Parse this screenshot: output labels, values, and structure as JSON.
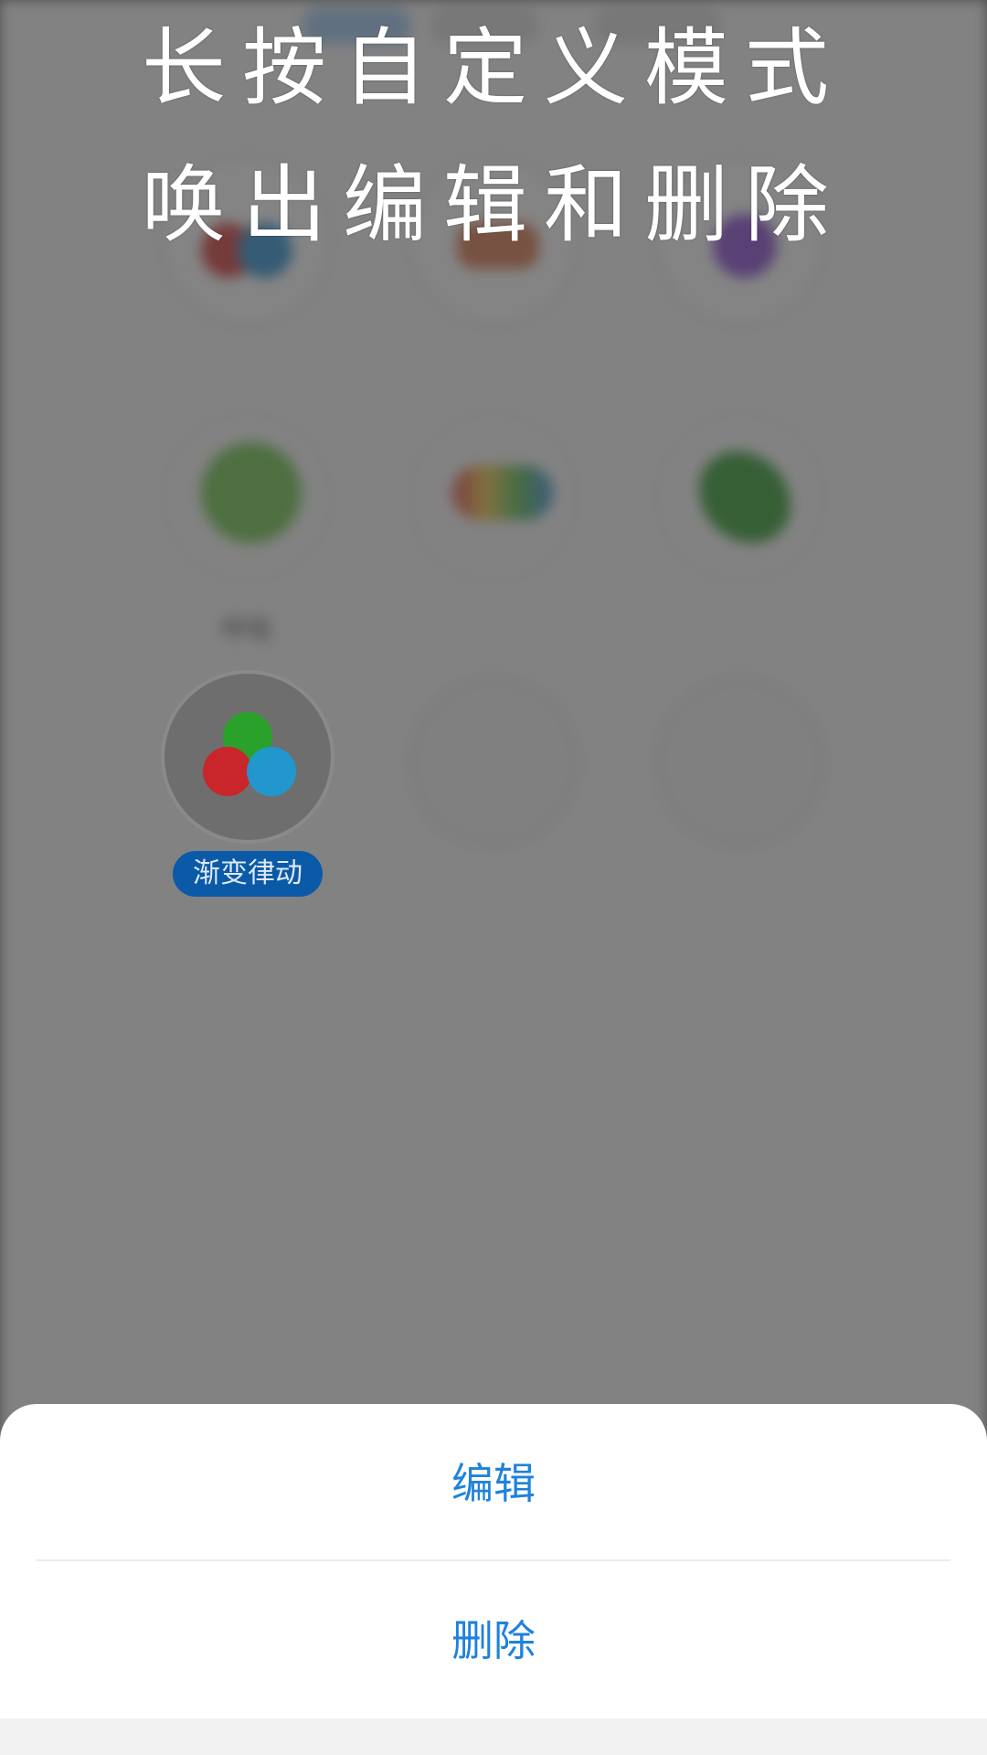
{
  "overlay_caption": {
    "line1": "长按自定义模式",
    "line2": "唤出编辑和删除"
  },
  "background_modes": [
    {
      "label": "呼吸",
      "icon": "green-swirl-icon"
    },
    {
      "label": "",
      "icon": "rainbow-blob-icon"
    },
    {
      "label": "",
      "icon": "green-leaves-icon"
    }
  ],
  "custom_mode": {
    "label": "渐变律动",
    "icon": "rgb-circles-icon",
    "colors": {
      "green": "#2aa12a",
      "red": "#c9262b",
      "blue": "#1b9ad6"
    }
  },
  "action_sheet": {
    "edit_label": "编辑",
    "delete_label": "删除"
  },
  "theme": {
    "accent": "#1f82dc",
    "label_bg": "#0a5aa8"
  }
}
